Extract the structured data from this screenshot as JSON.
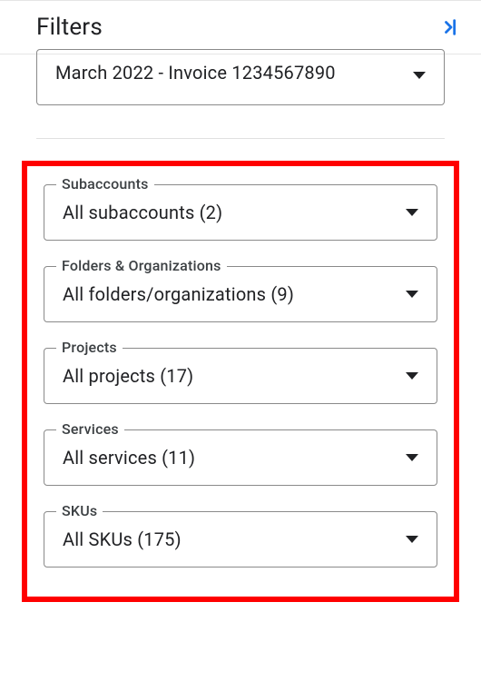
{
  "header": {
    "title": "Filters"
  },
  "invoice": {
    "value": "March 2022 - Invoice 1234567890"
  },
  "filters": [
    {
      "id": "subaccounts",
      "label": "Subaccounts",
      "value": "All subaccounts (2)"
    },
    {
      "id": "folders-orgs",
      "label": "Folders & Organizations",
      "value": "All folders/organizations (9)"
    },
    {
      "id": "projects",
      "label": "Projects",
      "value": "All projects (17)"
    },
    {
      "id": "services",
      "label": "Services",
      "value": "All services (11)"
    },
    {
      "id": "skus",
      "label": "SKUs",
      "value": "All SKUs (175)"
    }
  ]
}
